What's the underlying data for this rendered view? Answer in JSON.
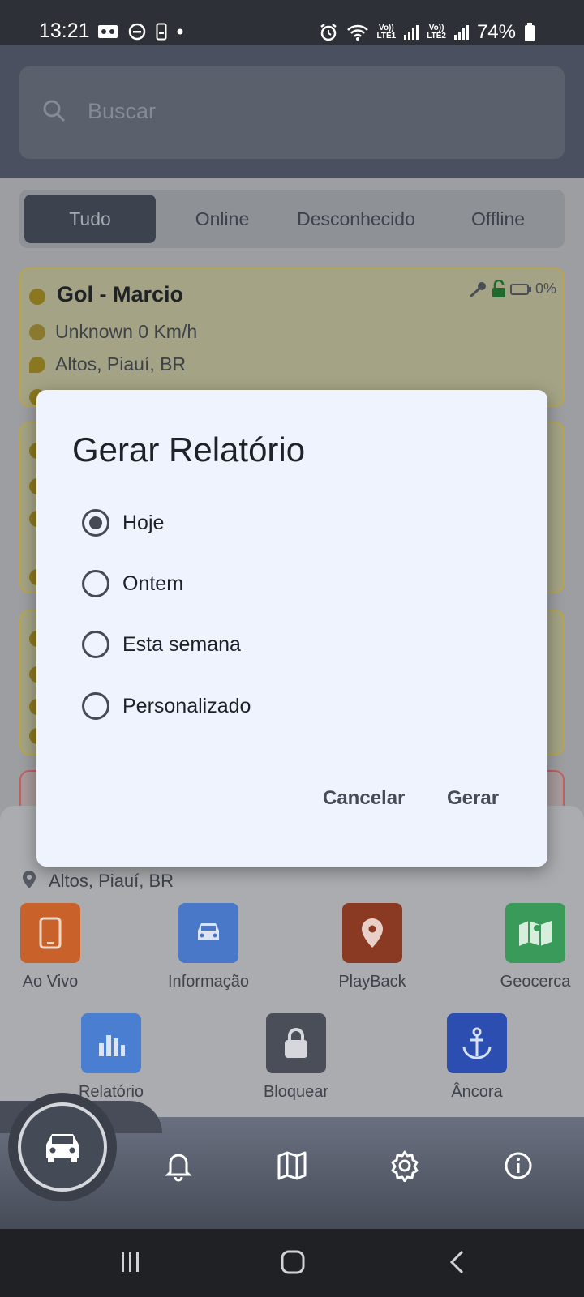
{
  "status_bar": {
    "time": "13:21",
    "lte1": "LTE1",
    "lte2": "LTE2",
    "volte": "Vo))",
    "battery": "74%"
  },
  "search": {
    "placeholder": "Buscar"
  },
  "segments": [
    {
      "label": "Tudo",
      "active": true
    },
    {
      "label": "Online",
      "active": false
    },
    {
      "label": "Desconhecido",
      "active": false
    },
    {
      "label": "Offline",
      "active": false
    }
  ],
  "cards": [
    {
      "title": "Gol - Marcio",
      "speed": "Unknown 0 Km/h",
      "location": "Altos, Piauí, BR",
      "battery": "0%"
    }
  ],
  "sheet": {
    "address": "Altos, Piauí, BR",
    "actions": [
      {
        "label": "Ao Vivo",
        "icon": "phone-icon",
        "color": "#c8622a"
      },
      {
        "label": "Informação",
        "icon": "car-icon",
        "color": "#4a78c8"
      },
      {
        "label": "PlayBack",
        "icon": "location-pin-icon",
        "color": "#8a3a22"
      },
      {
        "label": "Geocerca",
        "icon": "map-pin-icon",
        "color": "#3a9a5a"
      },
      {
        "label": "Relatório",
        "icon": "bar-chart-icon",
        "color": "#4a7ed0"
      },
      {
        "label": "Bloquear",
        "icon": "lock-icon",
        "color": "#4a4e58"
      },
      {
        "label": "Âncora",
        "icon": "anchor-icon",
        "color": "#2b4eb0"
      }
    ]
  },
  "dialog": {
    "title": "Gerar Relatório",
    "options": [
      {
        "label": "Hoje",
        "selected": true
      },
      {
        "label": "Ontem",
        "selected": false
      },
      {
        "label": "Esta semana",
        "selected": false
      },
      {
        "label": "Personalizado",
        "selected": false
      }
    ],
    "cancel_label": "Cancelar",
    "confirm_label": "Gerar"
  }
}
